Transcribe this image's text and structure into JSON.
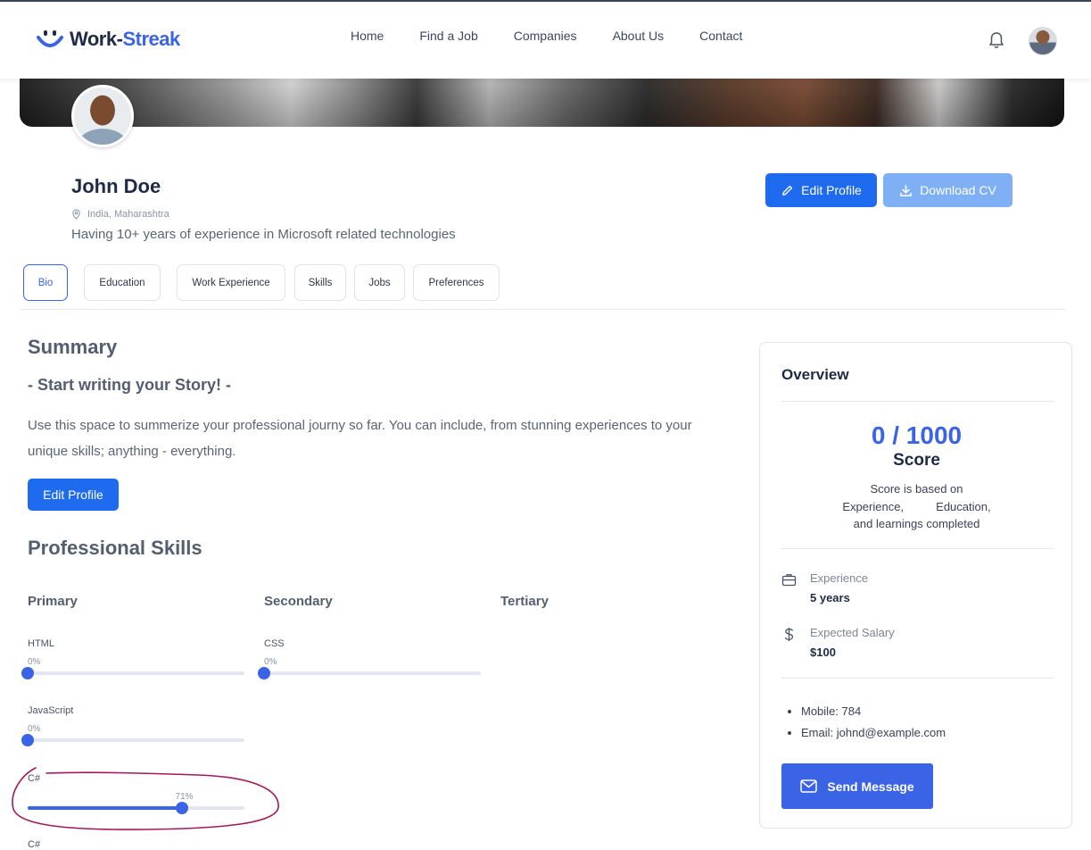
{
  "header": {
    "logo_work": "Work-",
    "logo_streak": "Streak",
    "nav": [
      "Home",
      "Find a Job",
      "Companies",
      "About Us",
      "Contact"
    ]
  },
  "profile": {
    "name": "John Doe",
    "location": "India, Maharashtra",
    "headline": "Having 10+ years of experience in Microsoft related technologies",
    "edit_label": "Edit Profile",
    "download_label": "Download CV"
  },
  "tabs": [
    "Bio",
    "Education",
    "Work Experience",
    "Skills",
    "Jobs",
    "Preferences"
  ],
  "active_tab": "Bio",
  "summary": {
    "title": "Summary",
    "story_title": "- Start writing your Story! -",
    "text": "Use this space to summerize your professional journy so far. You can include, from stunning experiences to your unique skills; anything - everything.",
    "edit_label": "Edit Profile"
  },
  "skills": {
    "title": "Professional Skills",
    "columns": [
      "Primary",
      "Secondary",
      "Tertiary"
    ],
    "primary": [
      {
        "name": "HTML",
        "percent": 0,
        "percent_label": "0%"
      },
      {
        "name": "JavaScript",
        "percent": 0,
        "percent_label": "0%"
      },
      {
        "name": "C#",
        "percent": 71,
        "percent_label": "71%"
      },
      {
        "name": "C#"
      }
    ],
    "secondary": [
      {
        "name": "CSS",
        "percent": 0,
        "percent_label": "0%"
      }
    ]
  },
  "overview": {
    "title": "Overview",
    "score": "0 / 1000",
    "score_label": "Score",
    "score_note_1": "Score is based on",
    "score_note_2": "Experience,          Education,",
    "score_note_3": "and learnings completed",
    "experience_label": "Experience",
    "experience_value": "5 years",
    "salary_label": "Expected Salary",
    "salary_value": "$100",
    "mobile": "Mobile: 784",
    "email": "Email: johnd@example.com",
    "send_label": "Send Message"
  },
  "colors": {
    "brand_blue": "#3b63e6",
    "primary_button": "#1f6bf0",
    "light_button": "#7fb0f5",
    "annotation": "#a3195b"
  }
}
